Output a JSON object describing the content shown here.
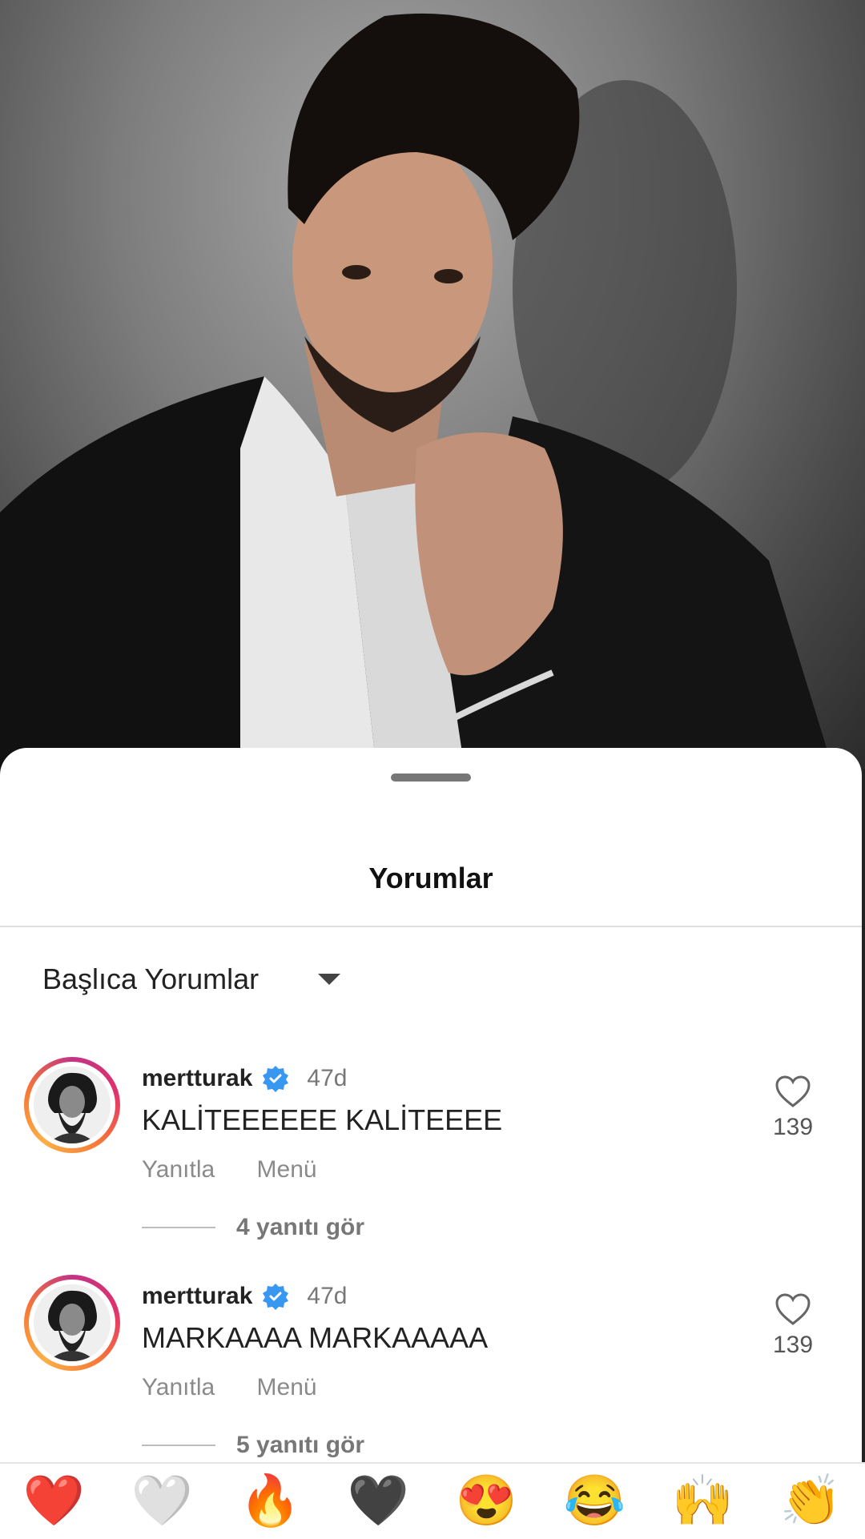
{
  "sheet": {
    "title": "Yorumlar",
    "sort_label": "Başlıca Yorumlar"
  },
  "comments": [
    {
      "username": "mertturak",
      "time": "47d",
      "text": "KALİTEEEEEE KALİTEEEE",
      "reply_label": "Yanıtla",
      "menu_label": "Menü",
      "likes": "139",
      "view_replies": "4 yanıtı gör"
    },
    {
      "username": "mertturak",
      "time": "47d",
      "text": "MARKAAAA MARKAAAAA",
      "reply_label": "Yanıtla",
      "menu_label": "Menü",
      "likes": "139",
      "view_replies": "5 yanıtı gör"
    }
  ],
  "emoji_bar": {
    "items": [
      "❤️",
      "🤍",
      "🔥",
      "🖤",
      "😍",
      "😂",
      "🙌",
      "👏"
    ]
  },
  "colors": {
    "verified": "#3897f0",
    "ring_start": "#c13584",
    "ring_end": "#fcaf45"
  },
  "icons": {
    "verified": "verified-badge-icon",
    "like": "heart-outline-icon",
    "sort": "caret-down-icon"
  }
}
